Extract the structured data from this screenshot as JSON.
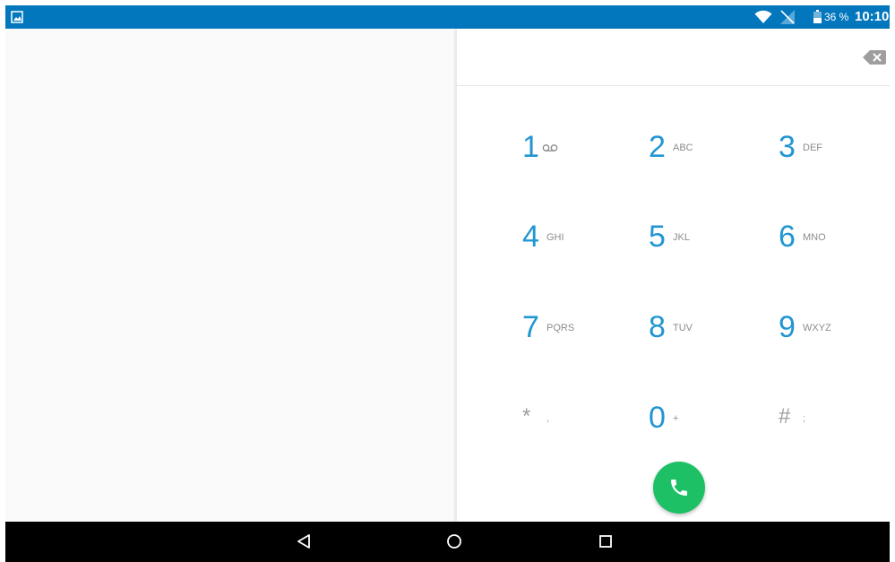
{
  "status_bar": {
    "battery_percent": "36 %",
    "time": "10:10",
    "left_icon": "image-notification-icon",
    "icons": [
      "wifi-icon",
      "no-sim-icon",
      "battery-icon"
    ]
  },
  "dialer": {
    "digits_value": "",
    "backspace_icon": "backspace-icon",
    "keys": [
      {
        "digit": "1",
        "letters": "",
        "icon": "voicemail-icon"
      },
      {
        "digit": "2",
        "letters": "ABC"
      },
      {
        "digit": "3",
        "letters": "DEF"
      },
      {
        "digit": "4",
        "letters": "GHI"
      },
      {
        "digit": "5",
        "letters": "JKL"
      },
      {
        "digit": "6",
        "letters": "MNO"
      },
      {
        "digit": "7",
        "letters": "PQRS"
      },
      {
        "digit": "8",
        "letters": "TUV"
      },
      {
        "digit": "9",
        "letters": "WXYZ"
      },
      {
        "digit": "*",
        "letters": ","
      },
      {
        "digit": "0",
        "letters": "+"
      },
      {
        "digit": "#",
        "letters": ";"
      }
    ],
    "call_icon": "phone-icon"
  },
  "navigation": {
    "icons": [
      "back-icon",
      "home-icon",
      "recents-icon"
    ]
  },
  "colors": {
    "status_bar": "#0277bd",
    "key_digit": "#2196d3",
    "call_button": "#1ec066",
    "nav_bar": "#000000"
  }
}
